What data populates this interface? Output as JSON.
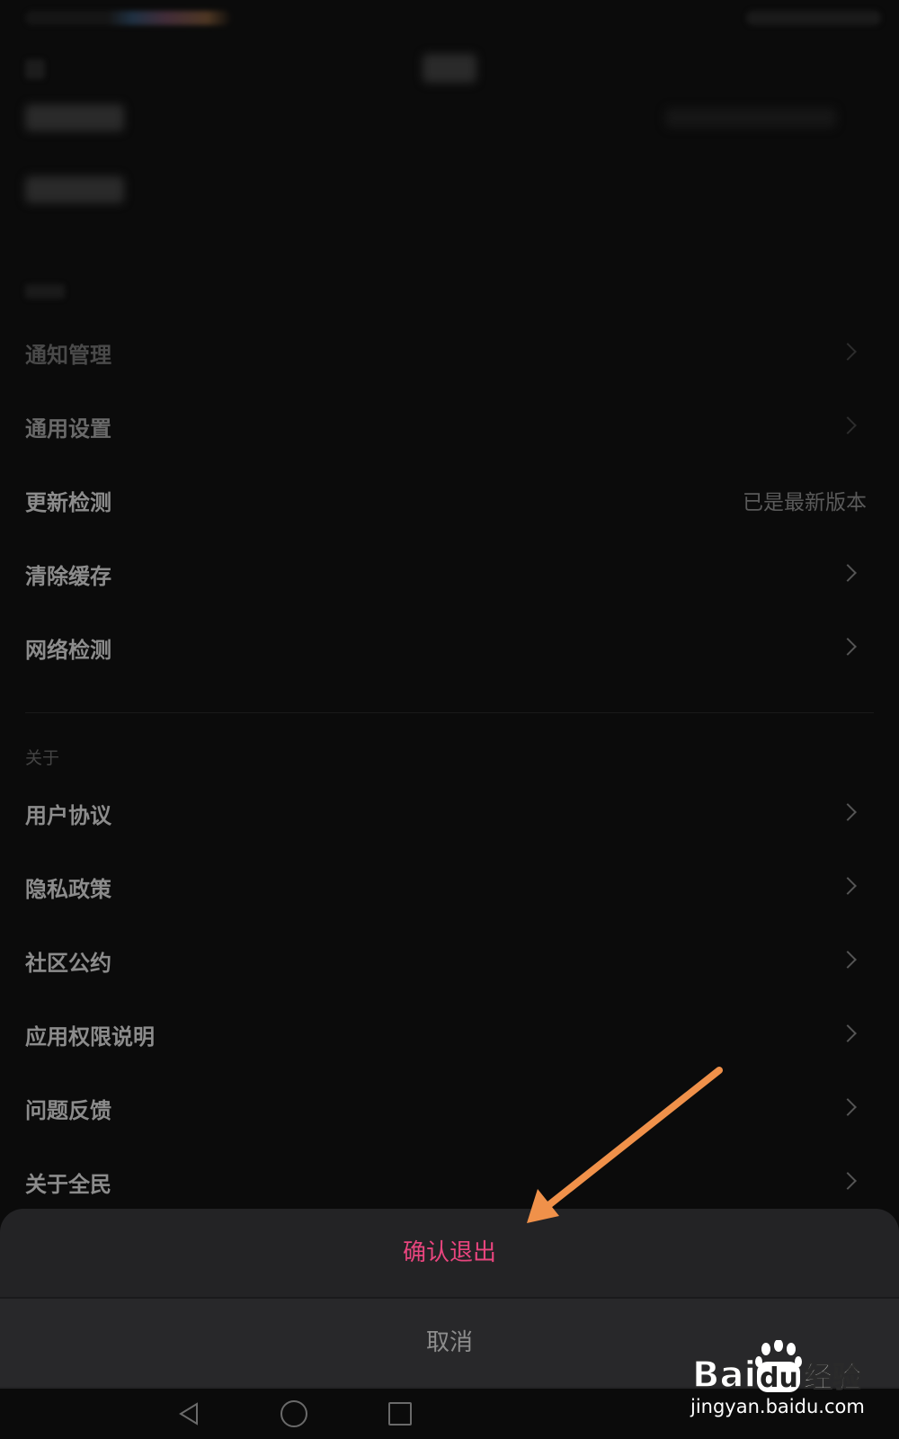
{
  "settings": {
    "rows": [
      {
        "label": "通知管理"
      },
      {
        "label": "通用设置"
      },
      {
        "label": "更新检测",
        "value": "已是最新版本"
      },
      {
        "label": "清除缓存"
      },
      {
        "label": "网络检测"
      }
    ],
    "about_section": "关于",
    "about_rows": [
      {
        "label": "用户协议"
      },
      {
        "label": "隐私政策"
      },
      {
        "label": "社区公约"
      },
      {
        "label": "应用权限说明"
      },
      {
        "label": "问题反馈"
      },
      {
        "label": "关于全民"
      }
    ]
  },
  "sheet": {
    "confirm_label": "确认退出",
    "cancel_label": "取消",
    "confirm_color": "#e8457e"
  },
  "navbar": {
    "icons": [
      "back-triangle-icon",
      "home-circle-icon",
      "recent-square-icon"
    ]
  },
  "annotation": {
    "arrow_color": "#f0914a"
  },
  "watermark": {
    "logo_text": "Baidu经验",
    "url": "jingyan.baidu.com"
  }
}
